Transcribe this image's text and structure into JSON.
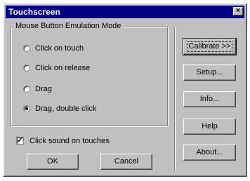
{
  "window": {
    "title": "Touchscreen",
    "close_glyph": "×"
  },
  "group": {
    "label": "Mouse Button Emulation Mode",
    "options": [
      {
        "label": "Click on touch",
        "selected": false
      },
      {
        "label": "Click on release",
        "selected": false
      },
      {
        "label": "Drag",
        "selected": false
      },
      {
        "label": "Drag, double click",
        "selected": true
      }
    ]
  },
  "checkbox": {
    "label": "Click sound on touches",
    "checked": true,
    "glyph": "✓"
  },
  "buttons": {
    "ok": "OK",
    "cancel": "Cancel",
    "calibrate": "Calibrate >>",
    "setup": "Setup...",
    "info": "Info...",
    "help": "Help",
    "about": "About..."
  },
  "colors": {
    "face": "#c0c0c0",
    "titlebar": "#000080"
  }
}
